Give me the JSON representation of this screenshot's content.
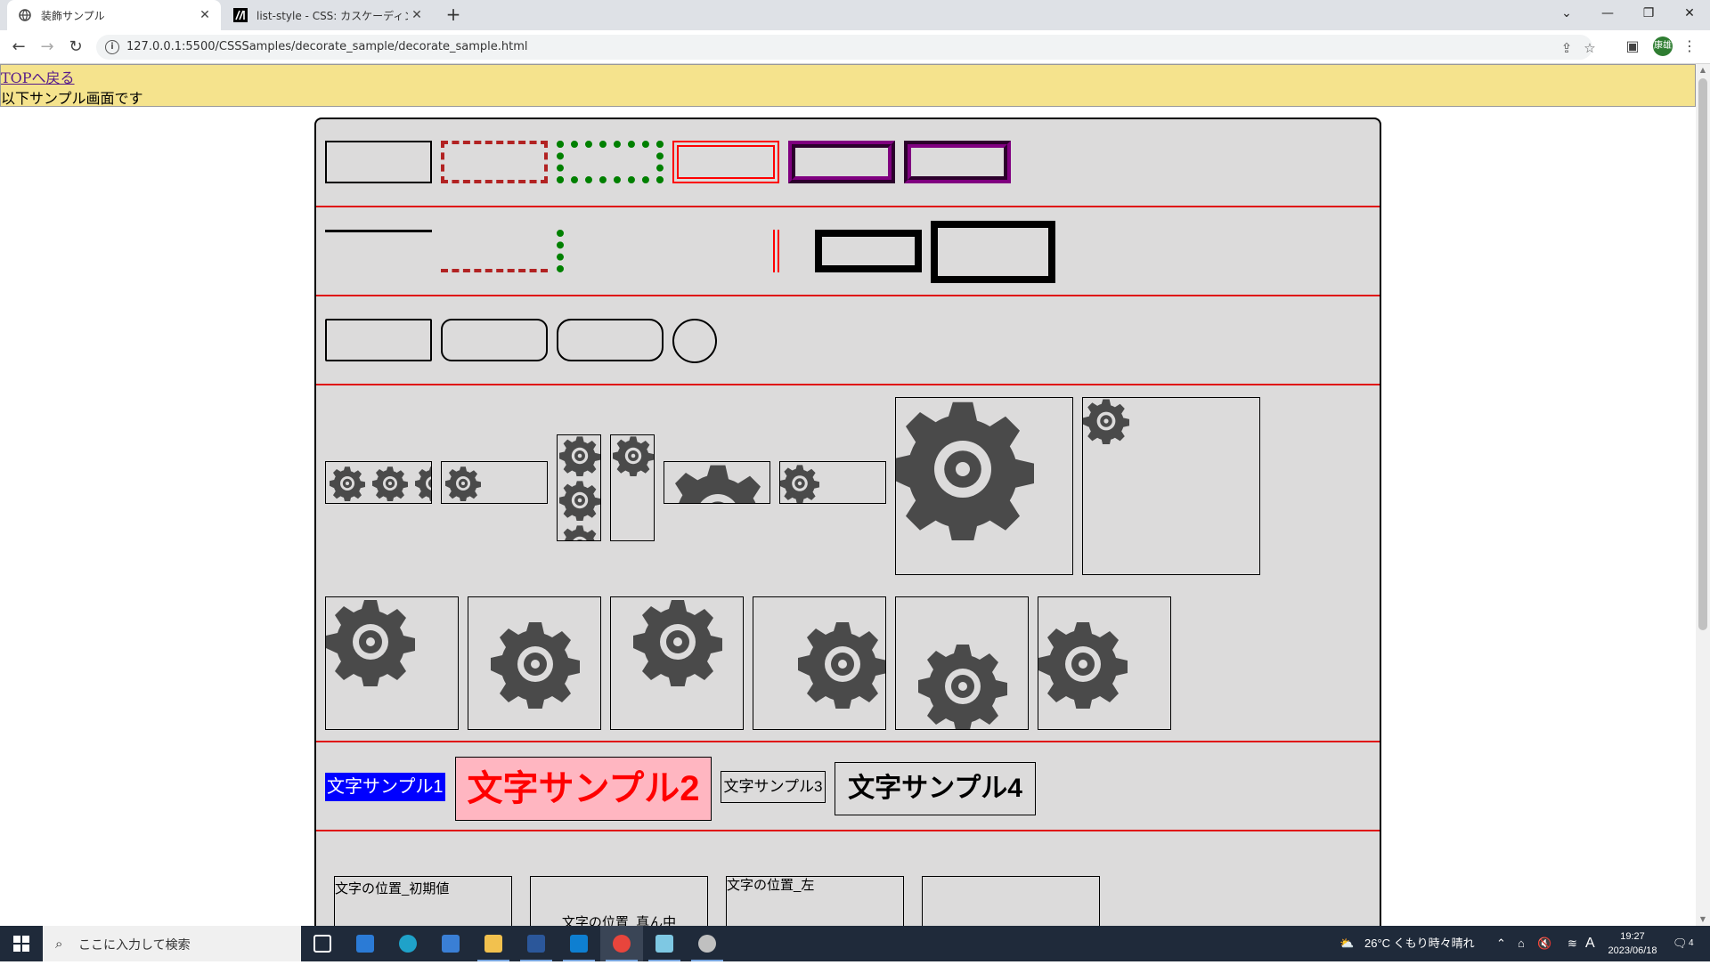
{
  "browser": {
    "tabs": [
      {
        "title": "装飾サンプル",
        "active": true,
        "favicon": "globe-icon"
      },
      {
        "title": "list-style - CSS: カスケーディングスタイルシート | MDN",
        "active": false,
        "favicon": "mdn-icon"
      }
    ],
    "new_tab_label": "+",
    "url": "127.0.0.1:5500/CSSSamples/decorate_sample/decorate_sample.html",
    "profile_initials": "康雄"
  },
  "page": {
    "back_link": "TOPへ戻る",
    "intro": "以下サンプル画面です",
    "text_samples": [
      "文字サンプル1",
      "文字サンプル2",
      "文字サンプル3",
      "文字サンプル4"
    ],
    "position_samples": [
      "文字の位置_初期値",
      "文字の位置_真ん中",
      "文字の位置_左",
      ""
    ]
  },
  "taskbar": {
    "search_placeholder": "ここに入力して検索",
    "weather": "26°C くもり時々晴れ",
    "time": "19:27",
    "date": "2023/06/18",
    "ime": "A",
    "notifications": "4"
  },
  "colors": {
    "accent_red": "#e01010",
    "sample_blue": "#0000ff",
    "sample_pink": "#ffb6c1",
    "header_bg": "#f5e38d",
    "gear": "#4a4a4a"
  }
}
